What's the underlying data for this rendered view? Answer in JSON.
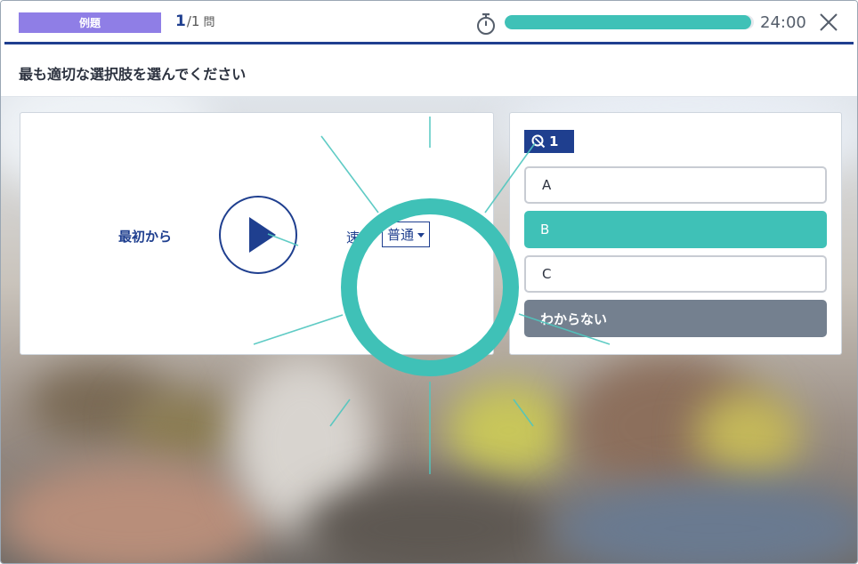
{
  "header": {
    "badge_label": "例題",
    "question_current": "1",
    "question_total": "/1",
    "question_unit": "問",
    "timer_text": "24:00",
    "progress_fraction": 0.99
  },
  "instruction": "最も適切な選択肢を選んでください",
  "player": {
    "restart_label": "最初から",
    "speed_label": "速",
    "speed_value": "普通"
  },
  "answers": {
    "question_number": "1",
    "options": [
      {
        "label": "A",
        "state": "plain"
      },
      {
        "label": "B",
        "state": "selected"
      },
      {
        "label": "C",
        "state": "plain"
      },
      {
        "label": "わからない",
        "state": "unknown"
      }
    ]
  },
  "colors": {
    "brand_navy": "#1f3f8f",
    "accent_teal": "#3fc1b7",
    "badge_purple": "#8f7ee6",
    "unknown_gray": "#74808f"
  },
  "icons": [
    "timer-icon",
    "close-icon",
    "play-icon",
    "search-icon",
    "dropdown-caret-icon"
  ]
}
